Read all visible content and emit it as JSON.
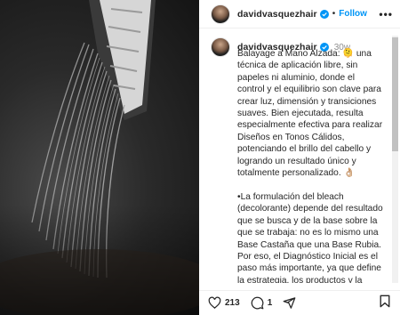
{
  "post": {
    "username": "davidvasquezhair",
    "follow_label": "Follow",
    "more_label": "•••"
  },
  "caption": {
    "username": "davidvasquezhair",
    "time": "30w",
    "paragraph1": "Balayage a Mano Alzada: 🫠 una técnica de aplicación libre, sin papeles ni aluminio, donde el control y el equilibrio son clave para crear luz, dimensión y transiciones suaves. Bien ejecutada, resulta especialmente efectiva para realizar Diseños en Tonos Cálidos, potenciando el brillo del cabello y logrando un resultado único y totalmente personalizado. 👌🏼",
    "paragraph2": "•La formulación del bleach (decolorante) depende del resultado que se busca y de la base sobre la que se trabaja: no es lo mismo una Base Castaña que una Base Rubia. Por eso, el Diagnóstico Inicial es el paso más importante, ya que define la estrategia, los productos y la forma de aplicación para conseguir el diseño y el color que se desea. ✅"
  },
  "actions": {
    "likes": "213",
    "comments": "1"
  },
  "colors": {
    "accent": "#0095f6",
    "verified": "#0095f6",
    "text": "#262626",
    "muted": "#8e8e8e"
  },
  "icons": [
    "verified-badge-icon",
    "heart-icon",
    "comment-icon",
    "share-icon",
    "bookmark-icon"
  ]
}
